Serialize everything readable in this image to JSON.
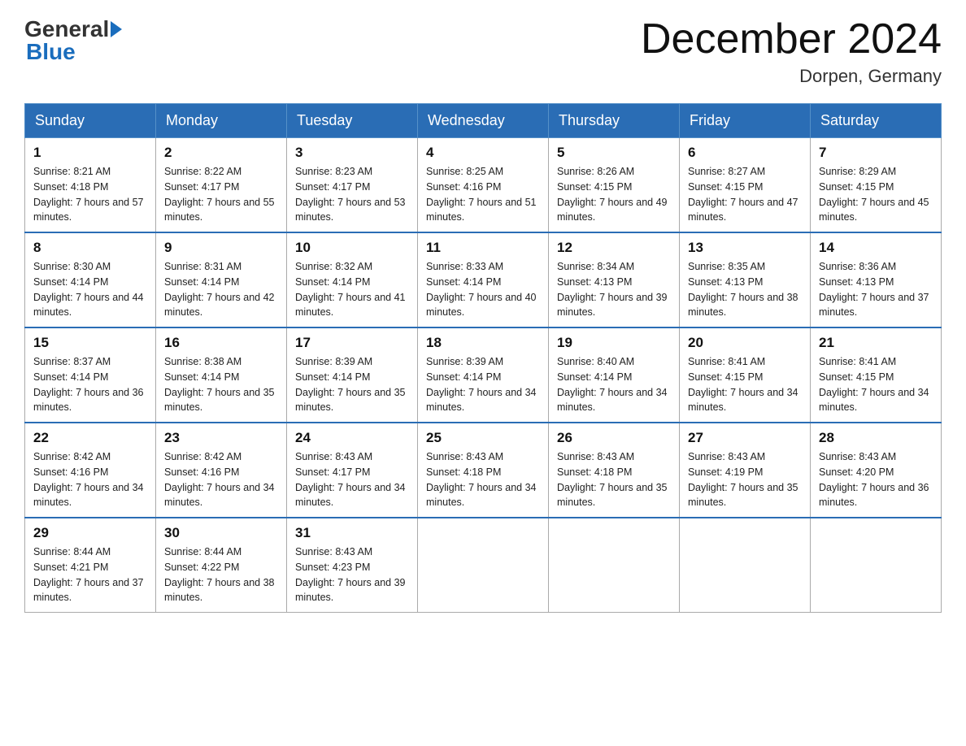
{
  "header": {
    "logo": {
      "part1": "General",
      "part2": "Blue"
    },
    "title": "December 2024",
    "location": "Dorpen, Germany"
  },
  "days_of_week": [
    "Sunday",
    "Monday",
    "Tuesday",
    "Wednesday",
    "Thursday",
    "Friday",
    "Saturday"
  ],
  "weeks": [
    [
      {
        "day": "1",
        "sunrise": "8:21 AM",
        "sunset": "4:18 PM",
        "daylight": "7 hours and 57 minutes."
      },
      {
        "day": "2",
        "sunrise": "8:22 AM",
        "sunset": "4:17 PM",
        "daylight": "7 hours and 55 minutes."
      },
      {
        "day": "3",
        "sunrise": "8:23 AM",
        "sunset": "4:17 PM",
        "daylight": "7 hours and 53 minutes."
      },
      {
        "day": "4",
        "sunrise": "8:25 AM",
        "sunset": "4:16 PM",
        "daylight": "7 hours and 51 minutes."
      },
      {
        "day": "5",
        "sunrise": "8:26 AM",
        "sunset": "4:15 PM",
        "daylight": "7 hours and 49 minutes."
      },
      {
        "day": "6",
        "sunrise": "8:27 AM",
        "sunset": "4:15 PM",
        "daylight": "7 hours and 47 minutes."
      },
      {
        "day": "7",
        "sunrise": "8:29 AM",
        "sunset": "4:15 PM",
        "daylight": "7 hours and 45 minutes."
      }
    ],
    [
      {
        "day": "8",
        "sunrise": "8:30 AM",
        "sunset": "4:14 PM",
        "daylight": "7 hours and 44 minutes."
      },
      {
        "day": "9",
        "sunrise": "8:31 AM",
        "sunset": "4:14 PM",
        "daylight": "7 hours and 42 minutes."
      },
      {
        "day": "10",
        "sunrise": "8:32 AM",
        "sunset": "4:14 PM",
        "daylight": "7 hours and 41 minutes."
      },
      {
        "day": "11",
        "sunrise": "8:33 AM",
        "sunset": "4:14 PM",
        "daylight": "7 hours and 40 minutes."
      },
      {
        "day": "12",
        "sunrise": "8:34 AM",
        "sunset": "4:13 PM",
        "daylight": "7 hours and 39 minutes."
      },
      {
        "day": "13",
        "sunrise": "8:35 AM",
        "sunset": "4:13 PM",
        "daylight": "7 hours and 38 minutes."
      },
      {
        "day": "14",
        "sunrise": "8:36 AM",
        "sunset": "4:13 PM",
        "daylight": "7 hours and 37 minutes."
      }
    ],
    [
      {
        "day": "15",
        "sunrise": "8:37 AM",
        "sunset": "4:14 PM",
        "daylight": "7 hours and 36 minutes."
      },
      {
        "day": "16",
        "sunrise": "8:38 AM",
        "sunset": "4:14 PM",
        "daylight": "7 hours and 35 minutes."
      },
      {
        "day": "17",
        "sunrise": "8:39 AM",
        "sunset": "4:14 PM",
        "daylight": "7 hours and 35 minutes."
      },
      {
        "day": "18",
        "sunrise": "8:39 AM",
        "sunset": "4:14 PM",
        "daylight": "7 hours and 34 minutes."
      },
      {
        "day": "19",
        "sunrise": "8:40 AM",
        "sunset": "4:14 PM",
        "daylight": "7 hours and 34 minutes."
      },
      {
        "day": "20",
        "sunrise": "8:41 AM",
        "sunset": "4:15 PM",
        "daylight": "7 hours and 34 minutes."
      },
      {
        "day": "21",
        "sunrise": "8:41 AM",
        "sunset": "4:15 PM",
        "daylight": "7 hours and 34 minutes."
      }
    ],
    [
      {
        "day": "22",
        "sunrise": "8:42 AM",
        "sunset": "4:16 PM",
        "daylight": "7 hours and 34 minutes."
      },
      {
        "day": "23",
        "sunrise": "8:42 AM",
        "sunset": "4:16 PM",
        "daylight": "7 hours and 34 minutes."
      },
      {
        "day": "24",
        "sunrise": "8:43 AM",
        "sunset": "4:17 PM",
        "daylight": "7 hours and 34 minutes."
      },
      {
        "day": "25",
        "sunrise": "8:43 AM",
        "sunset": "4:18 PM",
        "daylight": "7 hours and 34 minutes."
      },
      {
        "day": "26",
        "sunrise": "8:43 AM",
        "sunset": "4:18 PM",
        "daylight": "7 hours and 35 minutes."
      },
      {
        "day": "27",
        "sunrise": "8:43 AM",
        "sunset": "4:19 PM",
        "daylight": "7 hours and 35 minutes."
      },
      {
        "day": "28",
        "sunrise": "8:43 AM",
        "sunset": "4:20 PM",
        "daylight": "7 hours and 36 minutes."
      }
    ],
    [
      {
        "day": "29",
        "sunrise": "8:44 AM",
        "sunset": "4:21 PM",
        "daylight": "7 hours and 37 minutes."
      },
      {
        "day": "30",
        "sunrise": "8:44 AM",
        "sunset": "4:22 PM",
        "daylight": "7 hours and 38 minutes."
      },
      {
        "day": "31",
        "sunrise": "8:43 AM",
        "sunset": "4:23 PM",
        "daylight": "7 hours and 39 minutes."
      },
      null,
      null,
      null,
      null
    ]
  ]
}
